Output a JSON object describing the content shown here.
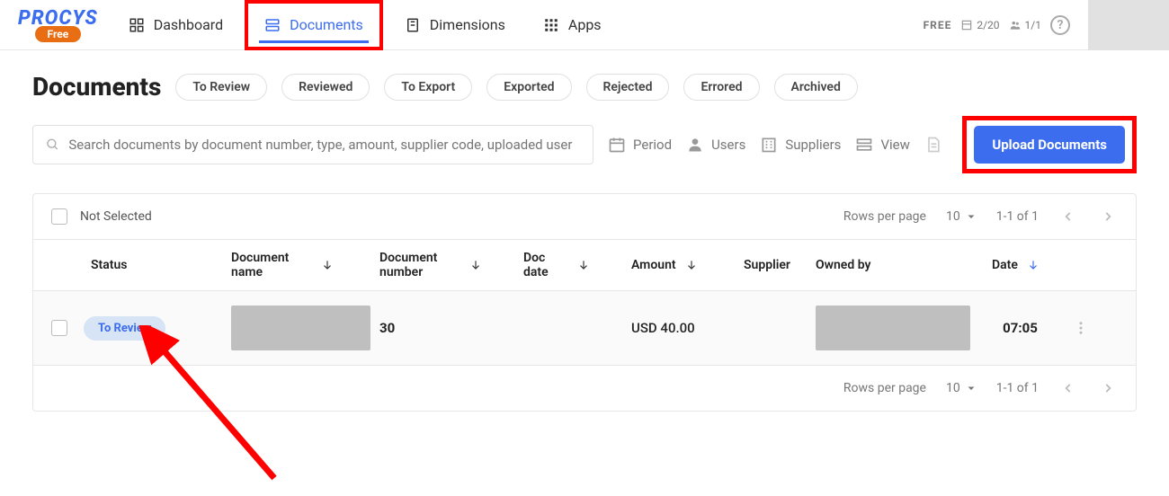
{
  "brand": {
    "name": "PROCYS",
    "badge": "Free"
  },
  "nav": {
    "dashboard": "Dashboard",
    "documents": "Documents",
    "dimensions": "Dimensions",
    "apps": "Apps"
  },
  "plan": {
    "free": "FREE",
    "docs": "2/20",
    "users": "1/1"
  },
  "page": {
    "title": "Documents",
    "filters": [
      "To Review",
      "Reviewed",
      "To Export",
      "Exported",
      "Rejected",
      "Errored",
      "Archived"
    ]
  },
  "search": {
    "placeholder": "Search documents by document number, type, amount, supplier code, uploaded user"
  },
  "tools": {
    "period": "Period",
    "users": "Users",
    "suppliers": "Suppliers",
    "view": "View"
  },
  "upload": {
    "label": "Upload Documents"
  },
  "table": {
    "not_selected": "Not Selected",
    "rpp_label": "Rows per page",
    "rpp_value": "10",
    "range": "1-1 of 1",
    "headers": {
      "status": "Status",
      "docname": "Document name",
      "docnum": "Document number",
      "docdate": "Doc date",
      "amount": "Amount",
      "supplier": "Supplier",
      "owned": "Owned by",
      "date": "Date"
    },
    "rows": [
      {
        "status": "To Review",
        "docnum": "30",
        "amount": "USD 40.00",
        "date": "07:05"
      }
    ]
  }
}
